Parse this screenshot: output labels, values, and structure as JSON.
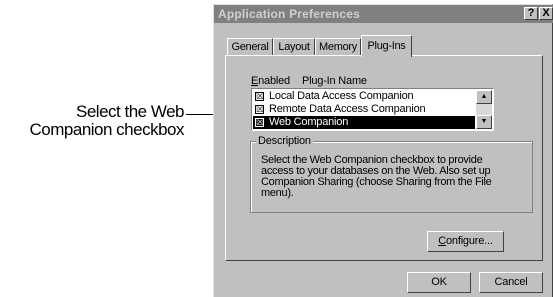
{
  "callout": {
    "line1": "Select the Web",
    "line2": "Companion checkbox"
  },
  "window": {
    "title": "Application Preferences",
    "help_button": "?",
    "close_button": "X"
  },
  "tabs": [
    {
      "label": "General"
    },
    {
      "label": "Layout"
    },
    {
      "label": "Memory"
    },
    {
      "label": "Plug-Ins",
      "active": true
    }
  ],
  "plugins": {
    "header_enabled_prefix": "E",
    "header_enabled_rest": "nabled",
    "header_name": "Plug-In Name",
    "check_glyph": "☒",
    "items": [
      {
        "name": "Local Data Access Companion",
        "checked": true,
        "selected": false
      },
      {
        "name": "Remote Data Access Companion",
        "checked": true,
        "selected": false
      },
      {
        "name": "Web Companion",
        "checked": true,
        "selected": true
      }
    ]
  },
  "description": {
    "label": "Description",
    "text": "Select the Web Companion checkbox to provide access to your databases on the Web. Also set up Companion Sharing (choose Sharing from the File menu)."
  },
  "buttons": {
    "configure_prefix": "C",
    "configure_rest": "onfigure...",
    "ok": "OK",
    "cancel": "Cancel"
  },
  "icons": {
    "scroll_up": "▲",
    "scroll_down": "▼"
  }
}
